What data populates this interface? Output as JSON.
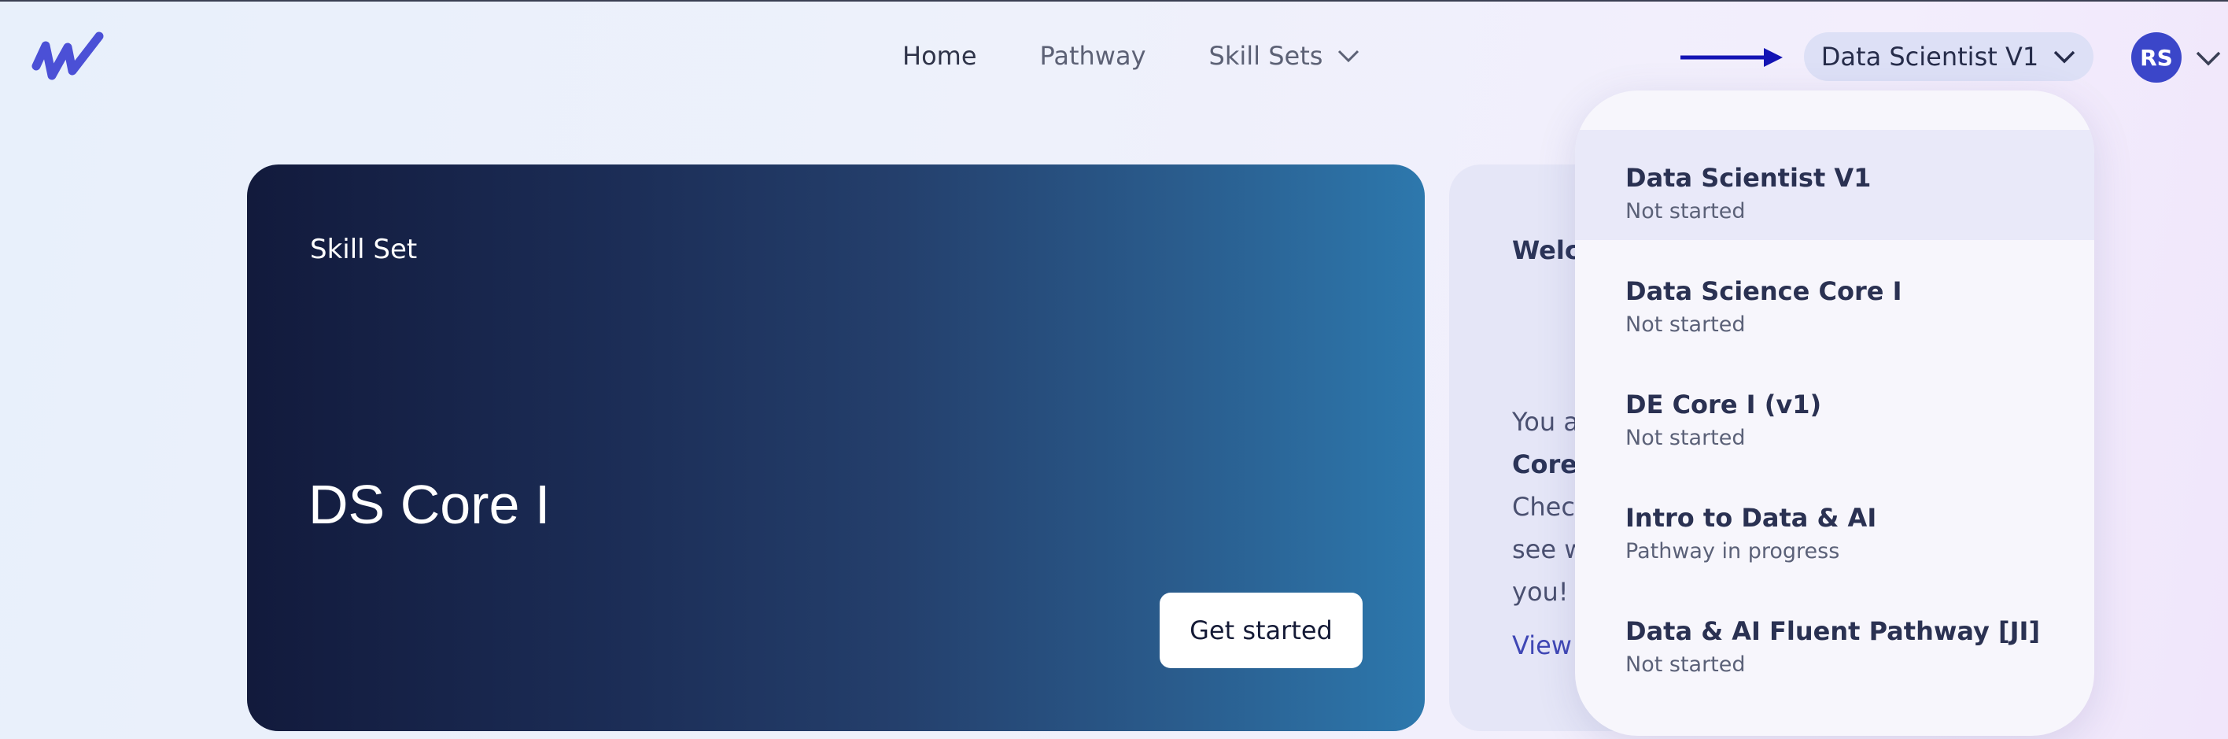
{
  "brand": {
    "logo_icon": "w-logo-icon",
    "accent": "#3b46c9"
  },
  "nav": {
    "home": "Home",
    "pathway": "Pathway",
    "skill_sets": "Skill Sets"
  },
  "track_selector": {
    "label": "Data Scientist V1",
    "icon": "chevron-down-icon"
  },
  "user": {
    "initials": "RS"
  },
  "hero": {
    "kicker": "Skill Set",
    "title": "DS Core I",
    "button": "Get started"
  },
  "side_card": {
    "heading": "Welco",
    "line1": "You a",
    "line2": "Core",
    "line3": "Chec",
    "line4": "see w",
    "line5": "you!",
    "link": "View"
  },
  "dropdown": {
    "items": [
      {
        "title": "Data Scientist V1",
        "status": "Not started",
        "selected": true
      },
      {
        "title": "Data Science Core I",
        "status": "Not started"
      },
      {
        "title": "DE Core I (v1)",
        "status": "Not started"
      },
      {
        "title": "Intro to Data & AI",
        "status": "Pathway in progress"
      },
      {
        "title": "Data & AI Fluent Pathway [JI]",
        "status": "Not started"
      }
    ]
  }
}
